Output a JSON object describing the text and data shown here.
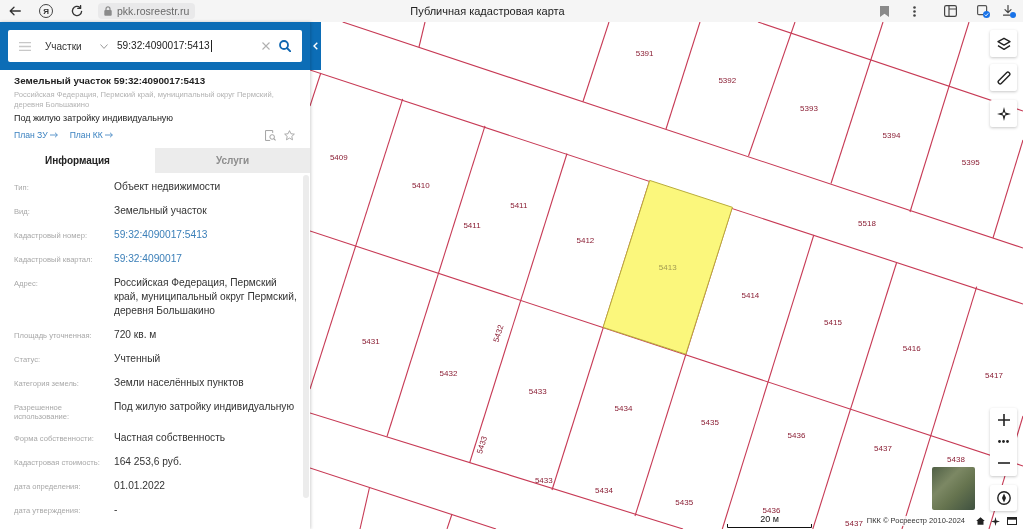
{
  "browser": {
    "logo": "Я",
    "url": "pkk.rosreestr.ru",
    "title": "Публичная кадастровая карта"
  },
  "search": {
    "layer": "Участки",
    "value": "59:32:4090017:5413"
  },
  "object": {
    "title": "Земельный участок 59:32:4090017:5413",
    "address": "Российская Федерация, Пермский край, муниципальный округ Пермский, деревня Большакино",
    "usage": "Под жилую затройку индивидуальную",
    "links": [
      "План ЗУ",
      "План КК"
    ]
  },
  "tabs": [
    {
      "label": "Информация",
      "selected": true
    },
    {
      "label": "Услуги",
      "selected": false
    }
  ],
  "fields": [
    {
      "label": "Тип:",
      "value": "Объект недвижимости",
      "kind": "text"
    },
    {
      "label": "Вид:",
      "value": "Земельный участок",
      "kind": "text"
    },
    {
      "label": "Кадастровый номер:",
      "value": "59:32:4090017:5413",
      "kind": "link"
    },
    {
      "label": "Кадастровый квартал:",
      "value": "59:32:4090017",
      "kind": "link"
    },
    {
      "label": "Адрес:",
      "value": "Российская Федерация, Пермский край, муниципальный округ Пермский, деревня Большакино",
      "kind": "text"
    },
    {
      "label": "Площадь уточненная:",
      "value": "720 кв. м",
      "kind": "text"
    },
    {
      "label": "Статус:",
      "value": "Учтенный",
      "kind": "text"
    },
    {
      "label": "Категория земель:",
      "value": "Земли населённых пунктов",
      "kind": "text"
    },
    {
      "label": "Разрешенное использование:",
      "value": "Под жилую затройку индивидуальную",
      "kind": "text"
    },
    {
      "label": "Форма собственности:",
      "value": "Частная собственность",
      "kind": "text"
    },
    {
      "label": "Кадастровая стоимость:",
      "value": "164 253,6 руб.",
      "kind": "text"
    },
    {
      "label": "дата определения:",
      "value": "01.01.2022",
      "kind": "text"
    },
    {
      "label": "дата утверждения:",
      "value": "-",
      "kind": "text"
    }
  ],
  "map": {
    "parcels": [
      {
        "number": "5391",
        "selected": false
      },
      {
        "number": "5392",
        "selected": false
      },
      {
        "number": "5393",
        "selected": false
      },
      {
        "number": "5394",
        "selected": false
      },
      {
        "number": "5395",
        "selected": false
      },
      {
        "number": "5409",
        "selected": false
      },
      {
        "number": "5410",
        "selected": false
      },
      {
        "number": "5411",
        "selected": false
      },
      {
        "number": "5411",
        "selected": false
      },
      {
        "number": "5412",
        "selected": false
      },
      {
        "number": "5413",
        "selected": true
      },
      {
        "number": "5518",
        "selected": false
      },
      {
        "number": "5414",
        "selected": false
      },
      {
        "number": "5415",
        "selected": false
      },
      {
        "number": "5416",
        "selected": false
      },
      {
        "number": "5417",
        "selected": false
      },
      {
        "number": "5431",
        "selected": false
      },
      {
        "number": "5432",
        "selected": false
      },
      {
        "number": "5432",
        "selected": false
      },
      {
        "number": "5433",
        "selected": false
      },
      {
        "number": "5434",
        "selected": false
      },
      {
        "number": "5435",
        "selected": false
      },
      {
        "number": "5436",
        "selected": false
      },
      {
        "number": "5437",
        "selected": false
      },
      {
        "number": "5438",
        "selected": false
      },
      {
        "number": "5433",
        "selected": false
      },
      {
        "number": "5433",
        "selected": false
      },
      {
        "number": "5434",
        "selected": false
      },
      {
        "number": "5435",
        "selected": false
      },
      {
        "number": "5436",
        "selected": false
      },
      {
        "number": "5437",
        "selected": false
      }
    ],
    "scale": "20 м",
    "attribution": "ПКК © Росреестр 2010-2024"
  }
}
